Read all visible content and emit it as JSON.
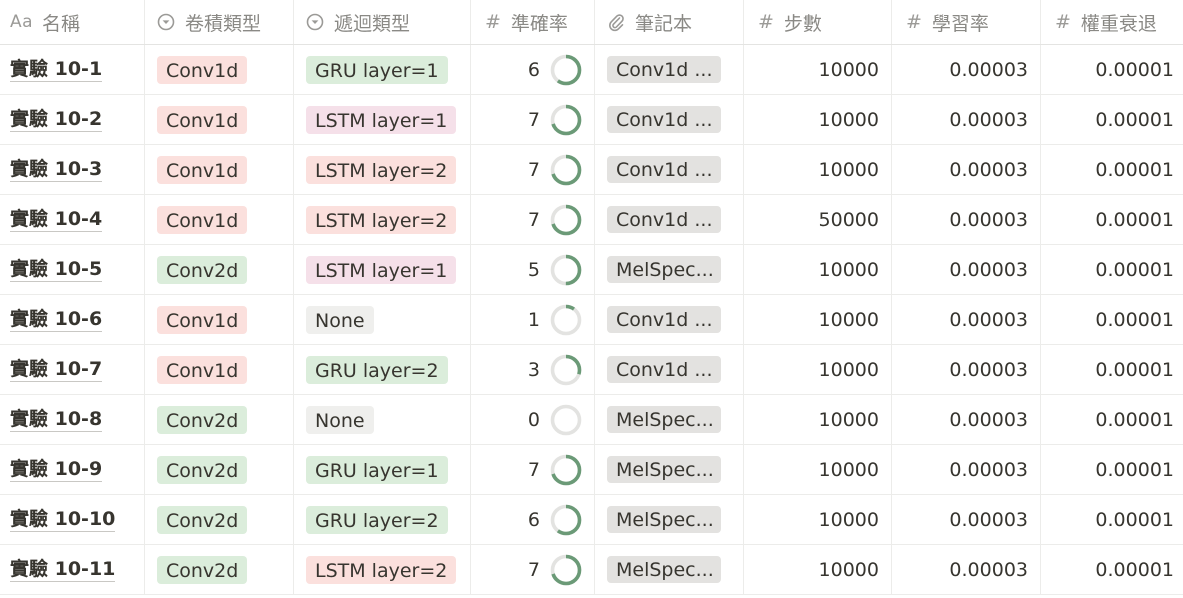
{
  "colors": {
    "conv1d": "#fbe0dd",
    "conv2d": "#dbeddb",
    "gru": "#dbeddb",
    "lstm1": "#f5e0e9",
    "lstm2": "#fbe0dd",
    "none": "#efefed",
    "ring_fill": "#6b9a77",
    "ring_track": "#e3e3e1"
  },
  "headers": {
    "name": {
      "icon": "Aa",
      "label": "名稱"
    },
    "conv_type": {
      "icon": "select-icon",
      "label": "卷積類型"
    },
    "rec_type": {
      "icon": "select-icon",
      "label": "遞迴類型"
    },
    "accuracy": {
      "icon": "#",
      "label": "準確率"
    },
    "notebook": {
      "icon": "paperclip-icon",
      "label": "筆記本"
    },
    "steps": {
      "icon": "#",
      "label": "步數"
    },
    "learning_rate": {
      "icon": "#",
      "label": "學習率"
    },
    "weight_decay": {
      "icon": "#",
      "label": "權重衰退"
    }
  },
  "rows": [
    {
      "name": "實驗 10-1",
      "conv": "Conv1d",
      "conv_color": "#fbe0dd",
      "rec": "GRU layer=1",
      "rec_color": "#dbeddb",
      "accuracy": "6",
      "acc_frac": 0.6,
      "notebook": "Conv1d ...",
      "steps": "10000",
      "lr": "0.00003",
      "wd": "0.00001"
    },
    {
      "name": "實驗 10-2",
      "conv": "Conv1d",
      "conv_color": "#fbe0dd",
      "rec": "LSTM layer=1",
      "rec_color": "#f5e0e9",
      "accuracy": "7",
      "acc_frac": 0.7,
      "notebook": "Conv1d ...",
      "steps": "10000",
      "lr": "0.00003",
      "wd": "0.00001"
    },
    {
      "name": "實驗 10-3",
      "conv": "Conv1d",
      "conv_color": "#fbe0dd",
      "rec": "LSTM layer=2",
      "rec_color": "#fbe0dd",
      "accuracy": "7",
      "acc_frac": 0.7,
      "notebook": "Conv1d ...",
      "steps": "10000",
      "lr": "0.00003",
      "wd": "0.00001"
    },
    {
      "name": "實驗 10-4",
      "conv": "Conv1d",
      "conv_color": "#fbe0dd",
      "rec": "LSTM layer=2",
      "rec_color": "#fbe0dd",
      "accuracy": "7",
      "acc_frac": 0.7,
      "notebook": "Conv1d ...",
      "steps": "50000",
      "lr": "0.00003",
      "wd": "0.00001"
    },
    {
      "name": "實驗 10-5",
      "conv": "Conv2d",
      "conv_color": "#dbeddb",
      "rec": "LSTM layer=1",
      "rec_color": "#f5e0e9",
      "accuracy": "5",
      "acc_frac": 0.5,
      "notebook": "MelSpec...",
      "steps": "10000",
      "lr": "0.00003",
      "wd": "0.00001"
    },
    {
      "name": "實驗 10-6",
      "conv": "Conv1d",
      "conv_color": "#fbe0dd",
      "rec": "None",
      "rec_color": "#efefed",
      "accuracy": "1",
      "acc_frac": 0.1,
      "notebook": "Conv1d ...",
      "steps": "10000",
      "lr": "0.00003",
      "wd": "0.00001"
    },
    {
      "name": "實驗 10-7",
      "conv": "Conv1d",
      "conv_color": "#fbe0dd",
      "rec": "GRU layer=2",
      "rec_color": "#dbeddb",
      "accuracy": "3",
      "acc_frac": 0.3,
      "notebook": "Conv1d ...",
      "steps": "10000",
      "lr": "0.00003",
      "wd": "0.00001"
    },
    {
      "name": "實驗 10-8",
      "conv": "Conv2d",
      "conv_color": "#dbeddb",
      "rec": "None",
      "rec_color": "#efefed",
      "accuracy": "0",
      "acc_frac": 0.0,
      "notebook": "MelSpec...",
      "steps": "10000",
      "lr": "0.00003",
      "wd": "0.00001"
    },
    {
      "name": "實驗 10-9",
      "conv": "Conv2d",
      "conv_color": "#dbeddb",
      "rec": "GRU layer=1",
      "rec_color": "#dbeddb",
      "accuracy": "7",
      "acc_frac": 0.7,
      "notebook": "MelSpec...",
      "steps": "10000",
      "lr": "0.00003",
      "wd": "0.00001"
    },
    {
      "name": "實驗 10-10",
      "conv": "Conv2d",
      "conv_color": "#dbeddb",
      "rec": "GRU layer=2",
      "rec_color": "#dbeddb",
      "accuracy": "6",
      "acc_frac": 0.6,
      "notebook": "MelSpec...",
      "steps": "10000",
      "lr": "0.00003",
      "wd": "0.00001"
    },
    {
      "name": "實驗 10-11",
      "conv": "Conv2d",
      "conv_color": "#dbeddb",
      "rec": "LSTM layer=2",
      "rec_color": "#fbe0dd",
      "accuracy": "7",
      "acc_frac": 0.7,
      "notebook": "MelSpec...",
      "steps": "10000",
      "lr": "0.00003",
      "wd": "0.00001"
    }
  ]
}
